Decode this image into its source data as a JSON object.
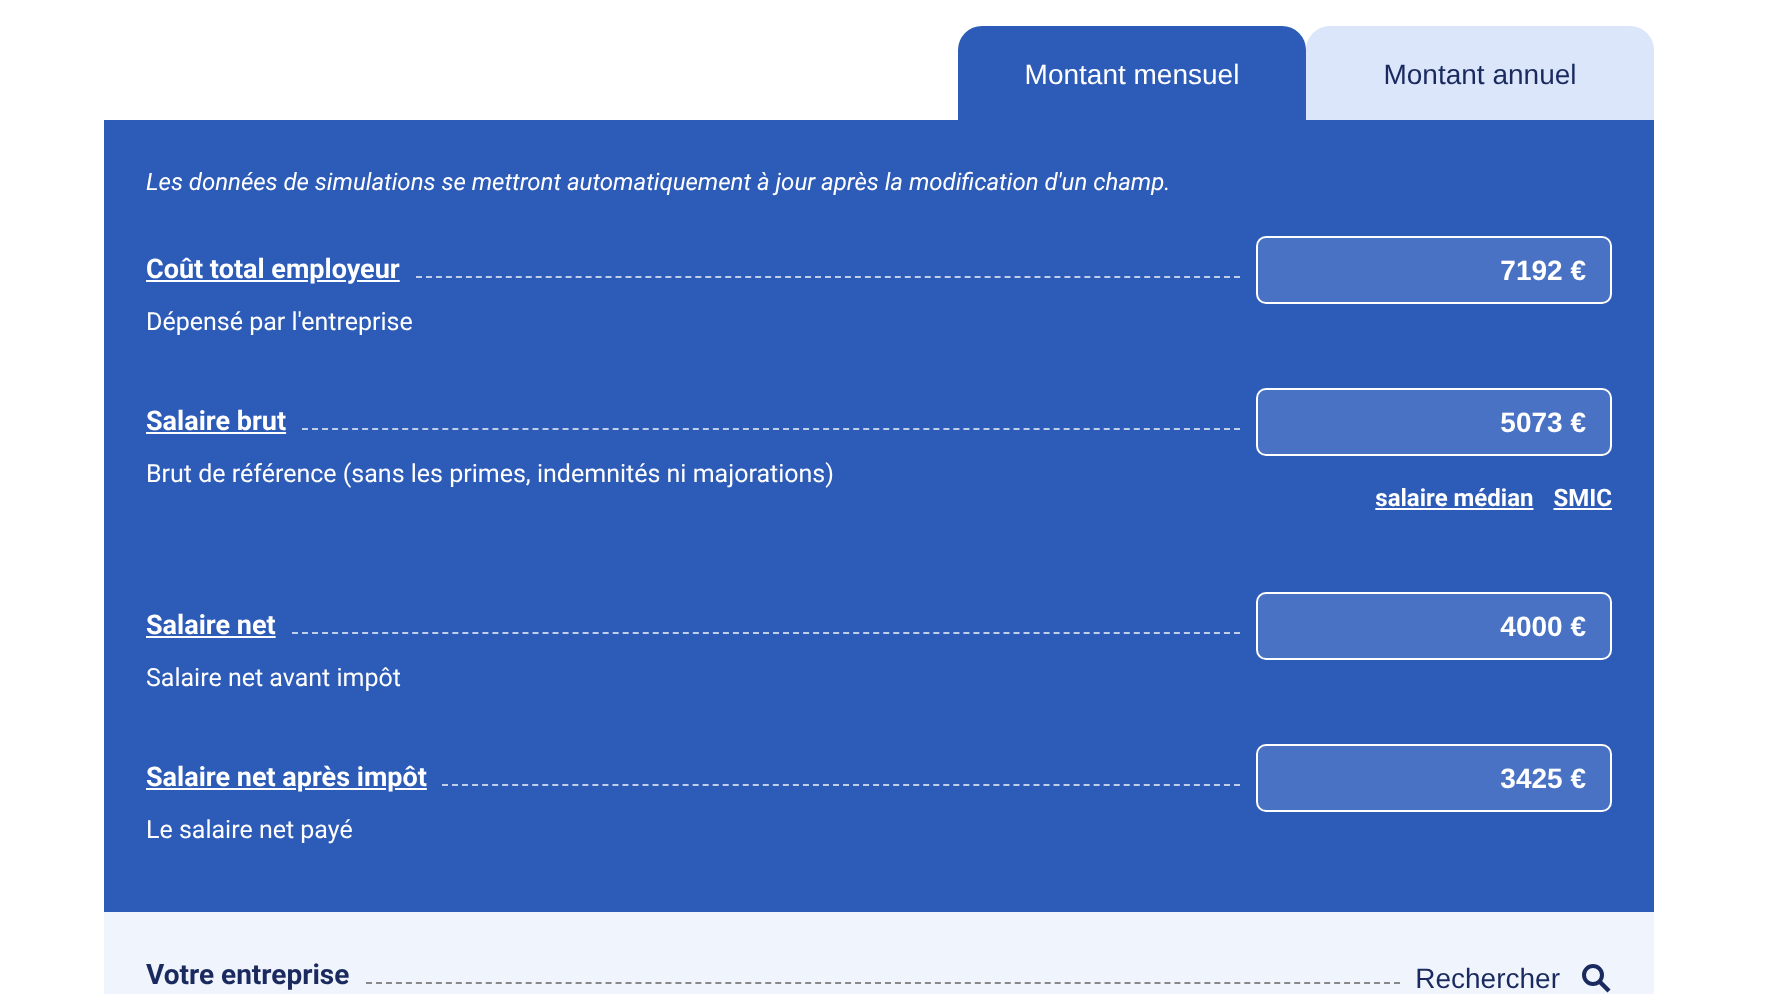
{
  "tabs": [
    {
      "label": "Montant mensuel",
      "selected": true
    },
    {
      "label": "Montant annuel",
      "selected": false
    }
  ],
  "notice": "Les données de simulations se mettront automatiquement à jour après la modification d'un champ.",
  "fields": [
    {
      "label": "Coût total employeur",
      "description": "Dépensé par l'entreprise",
      "value": "7192 €"
    },
    {
      "label": "Salaire brut",
      "description": "Brut de référence (sans les primes, indemnités ni majorations)",
      "value": "5073 €",
      "links": [
        "salaire médian",
        "SMIC"
      ]
    },
    {
      "label": "Salaire net",
      "description": "Salaire net avant impôt",
      "value": "4000 €"
    },
    {
      "label": "Salaire net après impôt",
      "description": "Le salaire net payé",
      "value": "3425 €"
    }
  ],
  "company": {
    "label": "Votre entreprise",
    "action": "Rechercher"
  }
}
